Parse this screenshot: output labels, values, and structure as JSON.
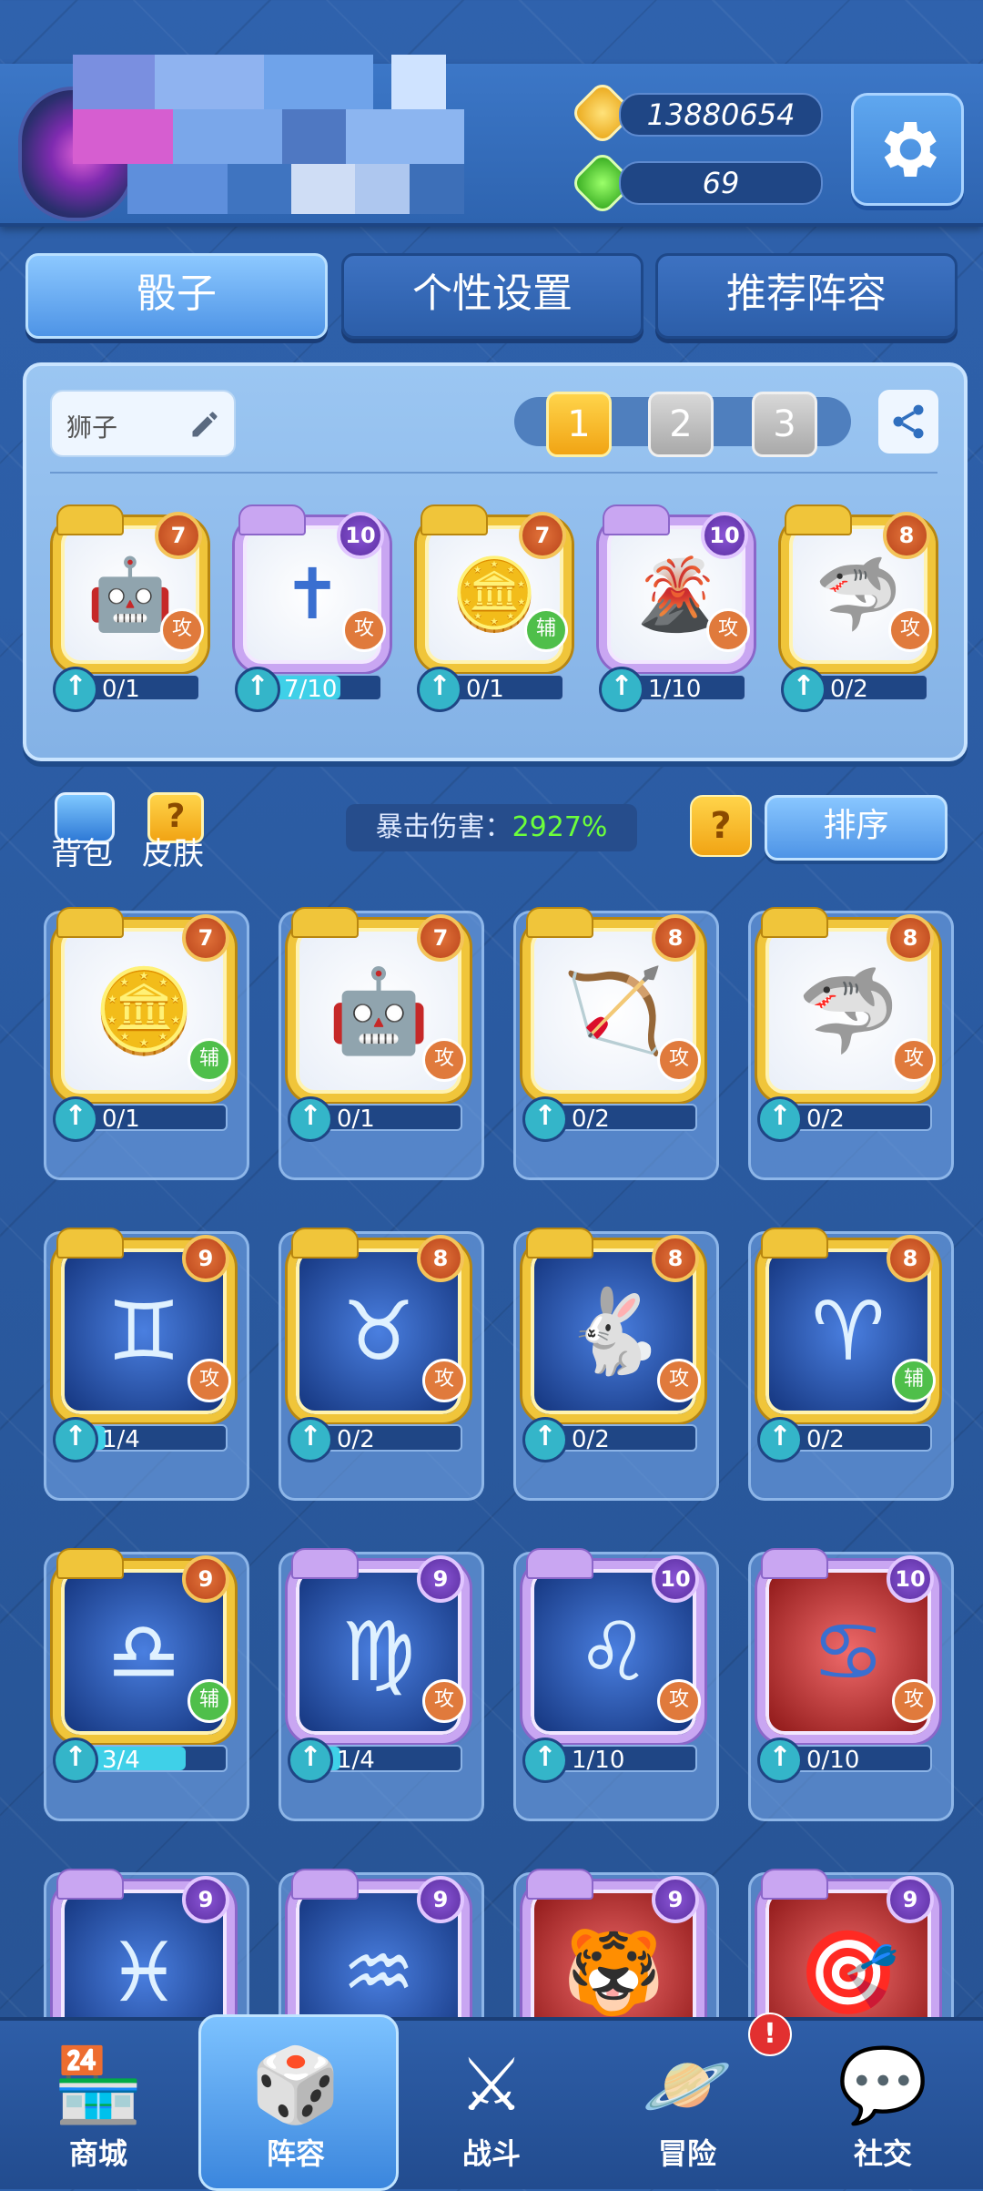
{
  "header": {
    "gold": "13880654",
    "gems": "69"
  },
  "tabs": [
    {
      "label": "骰子",
      "active": true
    },
    {
      "label": "个性设置",
      "active": false
    },
    {
      "label": "推荐阵容",
      "active": false
    }
  ],
  "deck": {
    "name": "狮子",
    "slots": [
      "1",
      "2",
      "3"
    ],
    "active_slot": "1",
    "cards": [
      {
        "name": "robot-dice",
        "level": "7",
        "type": "攻",
        "progress": "0/1",
        "fill": 0,
        "rarity": "gold",
        "icon": "robot-icon",
        "glyph": "🤖"
      },
      {
        "name": "cross-dice",
        "level": "10",
        "type": "攻",
        "progress": "7/10",
        "fill": 0.7,
        "rarity": "purple",
        "icon": "cross-icon",
        "glyph": "✝"
      },
      {
        "name": "coin-dice",
        "level": "7",
        "type": "辅",
        "progress": "0/1",
        "fill": 0,
        "rarity": "gold",
        "icon": "coin-icon",
        "glyph": "🪙"
      },
      {
        "name": "volcano-dice",
        "level": "10",
        "type": "攻",
        "progress": "1/10",
        "fill": 0.1,
        "rarity": "purple",
        "icon": "volcano-icon",
        "glyph": "🌋"
      },
      {
        "name": "shark-dice",
        "level": "8",
        "type": "攻",
        "progress": "0/2",
        "fill": 0,
        "rarity": "gold",
        "icon": "shark-icon",
        "glyph": "🦈"
      }
    ]
  },
  "side": {
    "bag": "背包",
    "skin": "皮肤"
  },
  "crit": {
    "label": "暴击伤害：",
    "value": "2927%"
  },
  "sort_label": "排序",
  "help_label": "?",
  "collection": [
    {
      "name": "coin-dice",
      "level": "7",
      "type": "辅",
      "progress": "0/1",
      "fill": 0,
      "rarity": "gold",
      "icon": "coin-icon",
      "glyph": "🪙"
    },
    {
      "name": "robot-dice",
      "level": "7",
      "type": "攻",
      "progress": "0/1",
      "fill": 0,
      "rarity": "gold",
      "icon": "robot-icon",
      "glyph": "🤖"
    },
    {
      "name": "sagittarius-dice",
      "level": "8",
      "type": "攻",
      "progress": "0/2",
      "fill": 0,
      "rarity": "gold",
      "icon": "archer-icon",
      "glyph": "🏹"
    },
    {
      "name": "shark-dice",
      "level": "8",
      "type": "攻",
      "progress": "0/2",
      "fill": 0,
      "rarity": "gold",
      "icon": "shark-icon",
      "glyph": "🦈"
    },
    {
      "name": "gemini-dice",
      "level": "9",
      "type": "攻",
      "progress": "1/4",
      "fill": 0.25,
      "rarity": "gold",
      "icon": "gemini-icon",
      "glyph": "♊"
    },
    {
      "name": "taurus-dice",
      "level": "8",
      "type": "攻",
      "progress": "0/2",
      "fill": 0,
      "rarity": "gold",
      "icon": "taurus-icon",
      "glyph": "♉"
    },
    {
      "name": "rabbit-dice",
      "level": "8",
      "type": "攻",
      "progress": "0/2",
      "fill": 0,
      "rarity": "gold",
      "icon": "rabbit-icon",
      "glyph": "🐇"
    },
    {
      "name": "aries-dice",
      "level": "8",
      "type": "辅",
      "progress": "0/2",
      "fill": 0,
      "rarity": "gold",
      "icon": "aries-icon",
      "glyph": "♈"
    },
    {
      "name": "libra-dice",
      "level": "9",
      "type": "辅",
      "progress": "3/4",
      "fill": 0.75,
      "rarity": "gold",
      "icon": "libra-icon",
      "glyph": "♎"
    },
    {
      "name": "virgo-dice",
      "level": "9",
      "type": "攻",
      "progress": "1/4",
      "fill": 0.25,
      "rarity": "purple",
      "icon": "virgo-icon",
      "glyph": "♍"
    },
    {
      "name": "leo-dice",
      "level": "10",
      "type": "攻",
      "progress": "1/10",
      "fill": 0.1,
      "rarity": "purple",
      "icon": "leo-icon",
      "glyph": "♌"
    },
    {
      "name": "cancer-dice",
      "level": "10",
      "type": "攻",
      "progress": "0/10",
      "fill": 0,
      "rarity": "purple",
      "icon": "cancer-icon",
      "glyph": "♋"
    },
    {
      "name": "pisces-dice",
      "level": "9",
      "type": "",
      "progress": "",
      "fill": 0,
      "rarity": "purple",
      "icon": "pisces-icon",
      "glyph": "♓"
    },
    {
      "name": "aquarius-dice",
      "level": "9",
      "type": "",
      "progress": "",
      "fill": 0,
      "rarity": "purple",
      "icon": "aquarius-icon",
      "glyph": "♒"
    },
    {
      "name": "tiger-dice",
      "level": "9",
      "type": "",
      "progress": "",
      "fill": 0,
      "rarity": "purple",
      "icon": "tiger-icon",
      "glyph": "🐯"
    },
    {
      "name": "target-dice",
      "level": "9",
      "type": "",
      "progress": "",
      "fill": 0,
      "rarity": "purple",
      "icon": "target-icon",
      "glyph": "🎯"
    }
  ],
  "nav": [
    {
      "label": "商城",
      "icon": "shop-icon",
      "glyph": "🏪"
    },
    {
      "label": "阵容",
      "icon": "dice-icon",
      "glyph": "🎲",
      "active": true
    },
    {
      "label": "战斗",
      "icon": "swords-icon",
      "glyph": "⚔"
    },
    {
      "label": "冒险",
      "icon": "planet-icon",
      "glyph": "🪐"
    },
    {
      "label": "社交",
      "icon": "chat-icon",
      "glyph": "💬"
    }
  ],
  "nav_badge": "!",
  "colors": {
    "accent": "#4e94e6",
    "gold": "#f0c53a",
    "purple": "#c9a6f2",
    "crit": "#6cff3b"
  }
}
